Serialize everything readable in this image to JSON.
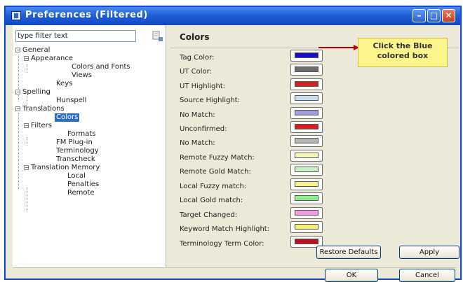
{
  "window": {
    "title": "Preferences (Filtered)"
  },
  "sidebar": {
    "filter_placeholder": "type filter text",
    "tree": [
      {
        "label": "General",
        "toggle": "−"
      },
      {
        "label": "Appearance",
        "toggle": "−"
      },
      {
        "label": "Colors and Fonts"
      },
      {
        "label": "Views"
      },
      {
        "label": "Keys"
      },
      {
        "label": "Spelling",
        "toggle": "−"
      },
      {
        "label": "Hunspell"
      },
      {
        "label": "Translations",
        "toggle": "−"
      },
      {
        "label": "Colors",
        "selected": true
      },
      {
        "label": "Filters",
        "toggle": "−"
      },
      {
        "label": "Formats"
      },
      {
        "label": "FM Plug-in"
      },
      {
        "label": "Terminology"
      },
      {
        "label": "Transcheck"
      },
      {
        "label": "Translation Memory",
        "toggle": "−"
      },
      {
        "label": "Local"
      },
      {
        "label": "Penalties"
      },
      {
        "label": "Remote"
      }
    ]
  },
  "main": {
    "title": "Colors",
    "rows": [
      {
        "label": "Tag Color:",
        "color": "#1a0fc4"
      },
      {
        "label": "UT Color:",
        "color": "#6d6d6d"
      },
      {
        "label": "UT Highlight:",
        "color": "#d81e1e"
      },
      {
        "label": "Source Highlight:",
        "color": "#c8def0"
      },
      {
        "label": "No Match:",
        "color": "#9e9edc"
      },
      {
        "label": "Unconfirmed:",
        "color": "#dc1c1c"
      },
      {
        "label": "No Match:",
        "color": "#b5b5b5"
      },
      {
        "label": "Remote Fuzzy Match:",
        "color": "#fbf8b4"
      },
      {
        "label": "Remote Gold Match:",
        "color": "#c7f0c4"
      },
      {
        "label": "Local Fuzzy match:",
        "color": "#f8f08c"
      },
      {
        "label": "Local Gold match:",
        "color": "#8eec8a"
      },
      {
        "label": "Target Changed:",
        "color": "#f09ae0"
      },
      {
        "label": "Keyword Match Highlight:",
        "color": "#f6f06e"
      },
      {
        "label": "Terminology Term Color:",
        "color": "#b81222"
      }
    ],
    "restore_defaults": "Restore Defaults",
    "apply": "Apply"
  },
  "callout": {
    "line1": "Click the Blue",
    "line2": "colored box"
  },
  "footer": {
    "ok": "OK",
    "cancel": "Cancel"
  },
  "colors": {
    "titlebar": "#1f5fd8",
    "selection": "#316ac5",
    "callout": "#fcf58c",
    "arrow": "#c00000"
  }
}
